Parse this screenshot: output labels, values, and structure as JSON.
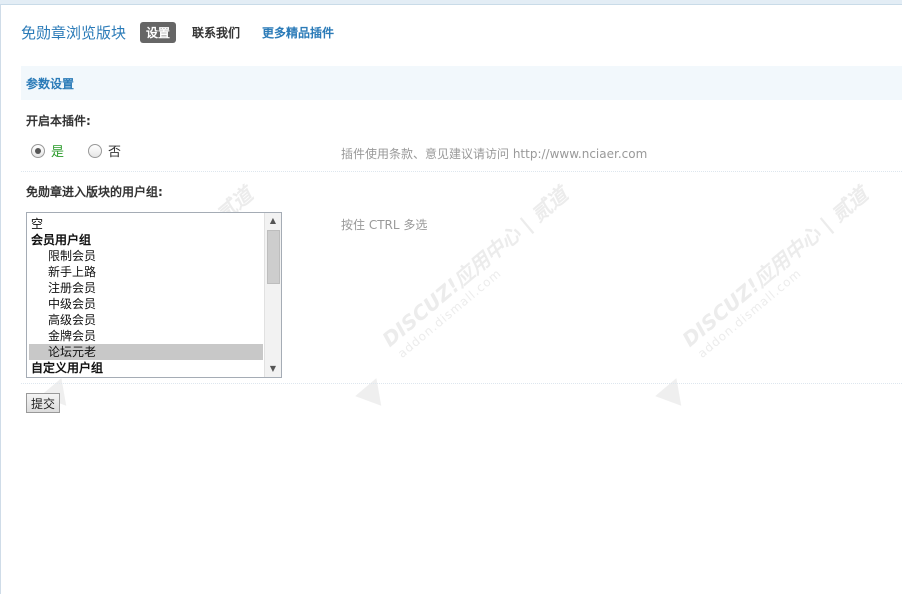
{
  "header": {
    "title": "免勋章浏览版块",
    "tabs": [
      {
        "label": "设置",
        "active": true
      },
      {
        "label": "联系我们",
        "active": false
      },
      {
        "label": "更多精品插件",
        "active": false
      }
    ]
  },
  "section": {
    "title": "参数设置"
  },
  "enable_plugin": {
    "label": "开启本插件:",
    "options": [
      {
        "label": "是",
        "checked": true
      },
      {
        "label": "否",
        "checked": false
      }
    ],
    "hint": "插件使用条款、意见建议请访问 http://www.nciaer.com"
  },
  "user_groups": {
    "label": "免勋章进入版块的用户组:",
    "hint": "按住 CTRL 多选",
    "options": [
      {
        "label": "空",
        "kind": "item"
      },
      {
        "label": "会员用户组",
        "kind": "group"
      },
      {
        "label": "限制会员",
        "kind": "child"
      },
      {
        "label": "新手上路",
        "kind": "child"
      },
      {
        "label": "注册会员",
        "kind": "child"
      },
      {
        "label": "中级会员",
        "kind": "child"
      },
      {
        "label": "高级会员",
        "kind": "child"
      },
      {
        "label": "金牌会员",
        "kind": "child"
      },
      {
        "label": "论坛元老",
        "kind": "child",
        "selected": true
      },
      {
        "label": "自定义用户组",
        "kind": "group"
      }
    ]
  },
  "submit_label": "提交",
  "watermark": {
    "line1": "DISCUZ!应用中心 | 贰道",
    "line2": "addon.dismall.com"
  },
  "colors": {
    "accent": "#2b7bb8",
    "section_bg": "#f2f8fc",
    "yes_color": "#2a9a2a",
    "tab_active_bg": "#666666"
  }
}
